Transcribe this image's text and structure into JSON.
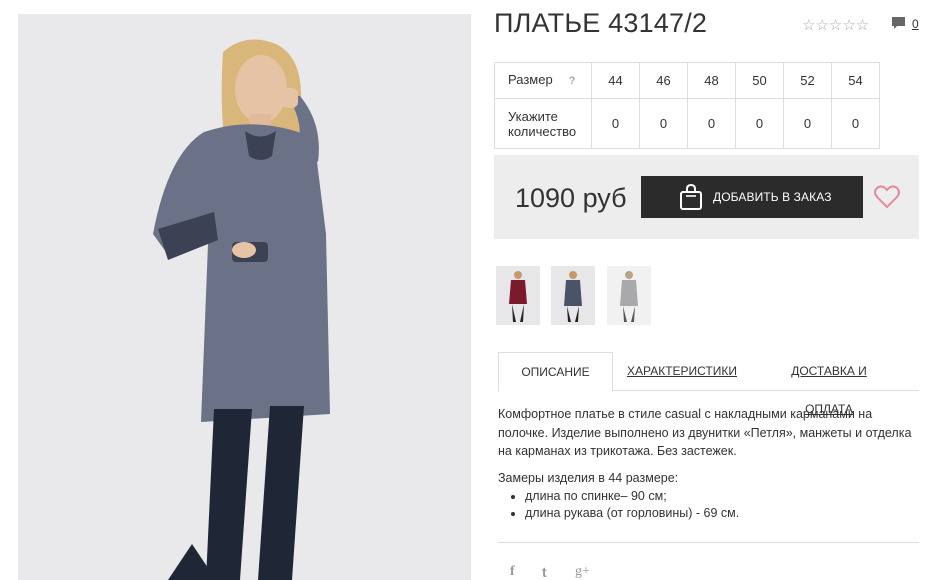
{
  "product": {
    "title": "ПЛАТЬЕ 43147/2",
    "rating_stars": "☆☆☆☆☆",
    "comment_count": "0"
  },
  "size_table": {
    "size_label": "Размер",
    "help_mark": "?",
    "sizes": [
      "44",
      "46",
      "48",
      "50",
      "52",
      "54"
    ],
    "quantity_label": "Укажите количество",
    "quantities": [
      "0",
      "0",
      "0",
      "0",
      "0",
      "0"
    ]
  },
  "purchase": {
    "price": "1090 руб",
    "add_button_label": "ДОБАВИТЬ В ЗАКАЗ"
  },
  "tabs": [
    "ОПИСАНИЕ",
    "ХАРАКТЕРИСТИКИ",
    "ДОСТАВКА И ОПЛАТА"
  ],
  "description": {
    "text": "Комфортное платье в стиле casual с накладными карманами на полочке. Изделие выполнено из двунитки «Петля», манжеты и отделка на карманах из трикотажа. Без застежек.",
    "measurements_title": "Замеры изделия в 44 размере:",
    "measurements": [
      "длина по спинке– 90 см;",
      "длина рукава (от горловины) - 69 см."
    ]
  },
  "social": [
    "f",
    "t",
    "g+"
  ],
  "colors": {
    "button_bg": "#2b2b2b",
    "price_bar_bg": "#ededed",
    "heart": "#e48b9b",
    "dress_main": "#6b7287",
    "thumb_colors": [
      "#7a1a2c",
      "#4a5466",
      "#a9a9ab"
    ]
  }
}
